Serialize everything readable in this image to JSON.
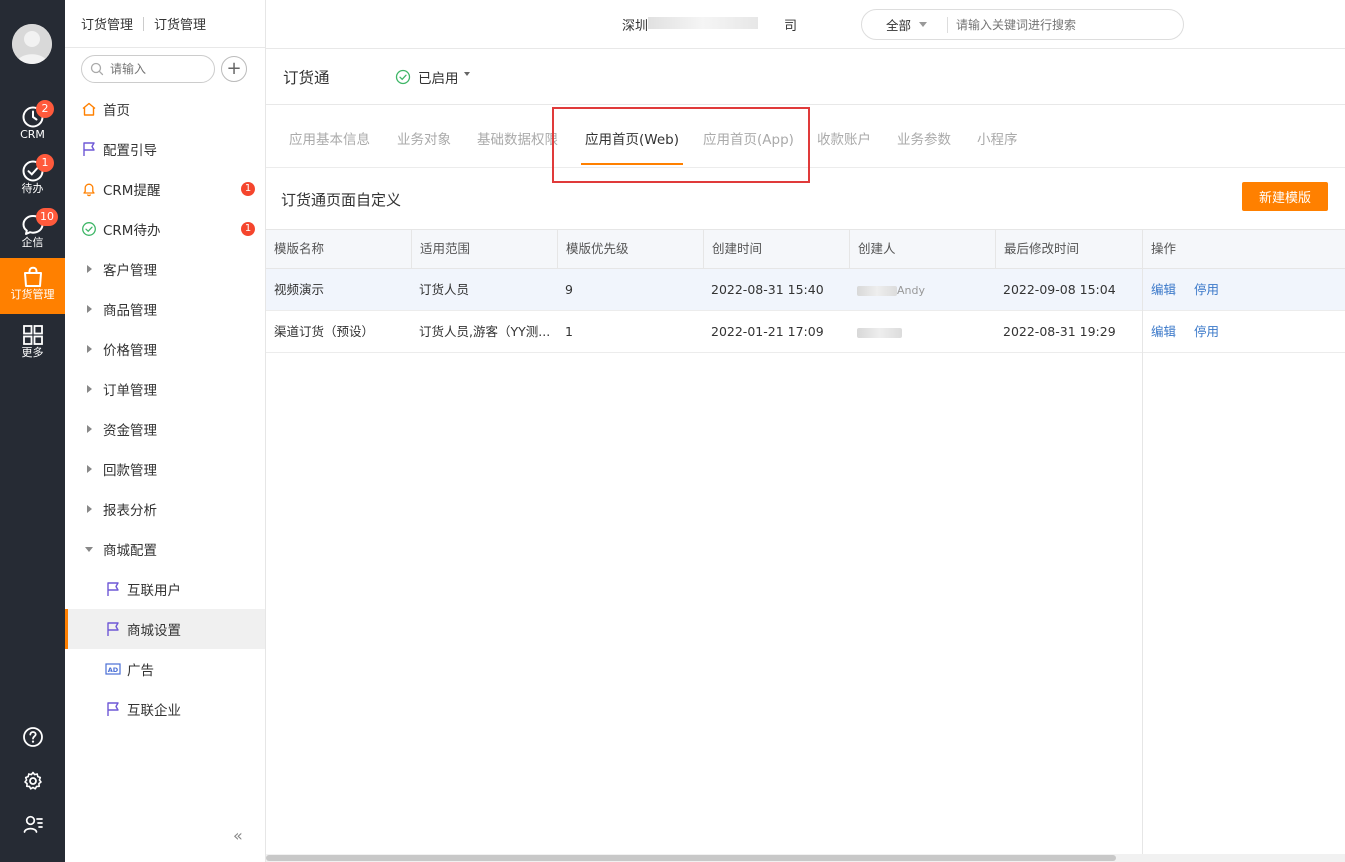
{
  "rail": {
    "items": [
      {
        "label": "CRM",
        "badge": "2"
      },
      {
        "label": "待办",
        "badge": "1"
      },
      {
        "label": "企信",
        "badge": "10"
      },
      {
        "label": "订货管理",
        "badge": ""
      },
      {
        "label": "更多",
        "badge": ""
      }
    ],
    "accent": "#ff8000"
  },
  "nav": {
    "breadcrumb": [
      "订货管理",
      "订货管理"
    ],
    "search_placeholder": "请输入",
    "add_label": "+",
    "items": [
      {
        "label": "首页",
        "type": "home"
      },
      {
        "label": "配置引导",
        "type": "flag"
      },
      {
        "label": "CRM提醒",
        "type": "bell",
        "dot": "1"
      },
      {
        "label": "CRM待办",
        "type": "check",
        "dot": "1"
      },
      {
        "label": "客户管理",
        "type": "group"
      },
      {
        "label": "商品管理",
        "type": "group"
      },
      {
        "label": "价格管理",
        "type": "group"
      },
      {
        "label": "订单管理",
        "type": "group"
      },
      {
        "label": "资金管理",
        "type": "group"
      },
      {
        "label": "回款管理",
        "type": "group"
      },
      {
        "label": "报表分析",
        "type": "group"
      },
      {
        "label": "商城配置",
        "type": "group-open"
      },
      {
        "label": "互联用户",
        "type": "sub-flag"
      },
      {
        "label": "商城设置",
        "type": "sub-flag",
        "selected": true
      },
      {
        "label": "广告",
        "type": "sub-ad"
      },
      {
        "label": "互联企业",
        "type": "sub-flag"
      }
    ],
    "collapse_label": "«"
  },
  "topbar": {
    "company": "深圳",
    "company_suffix": "司",
    "search_scope": "全部",
    "search_placeholder": "请输入关键词进行搜索"
  },
  "app": {
    "title": "订货通",
    "status": "已启用"
  },
  "tabs": [
    {
      "label": "应用基本信息",
      "active": false
    },
    {
      "label": "业务对象",
      "active": false
    },
    {
      "label": "基础数据权限",
      "active": false
    },
    {
      "label": "应用首页(Web)",
      "active": true
    },
    {
      "label": "应用首页(App)",
      "active": false
    },
    {
      "label": "收款账户",
      "active": false
    },
    {
      "label": "业务参数",
      "active": false
    },
    {
      "label": "小程序",
      "active": false
    }
  ],
  "section": {
    "title": "订货通页面自定义",
    "new_button": "新建模版"
  },
  "table": {
    "columns": [
      "模版名称",
      "适用范围",
      "模版优先级",
      "创建时间",
      "创建人",
      "最后修改时间",
      "操作"
    ],
    "rows": [
      {
        "name": "视频演示",
        "scope": "订货人员",
        "priority": "9",
        "created": "2022-08-31 15:40",
        "creator": "Andy",
        "modified": "2022-09-08 15:04",
        "edit": "编辑",
        "disable": "停用"
      },
      {
        "name": "渠道订货（预设）",
        "scope": "订货人员,游客（YY测...",
        "priority": "1",
        "created": "2022-01-21 17:09",
        "creator": "",
        "modified": "2022-08-31 19:29",
        "edit": "编辑",
        "disable": "停用"
      }
    ]
  }
}
